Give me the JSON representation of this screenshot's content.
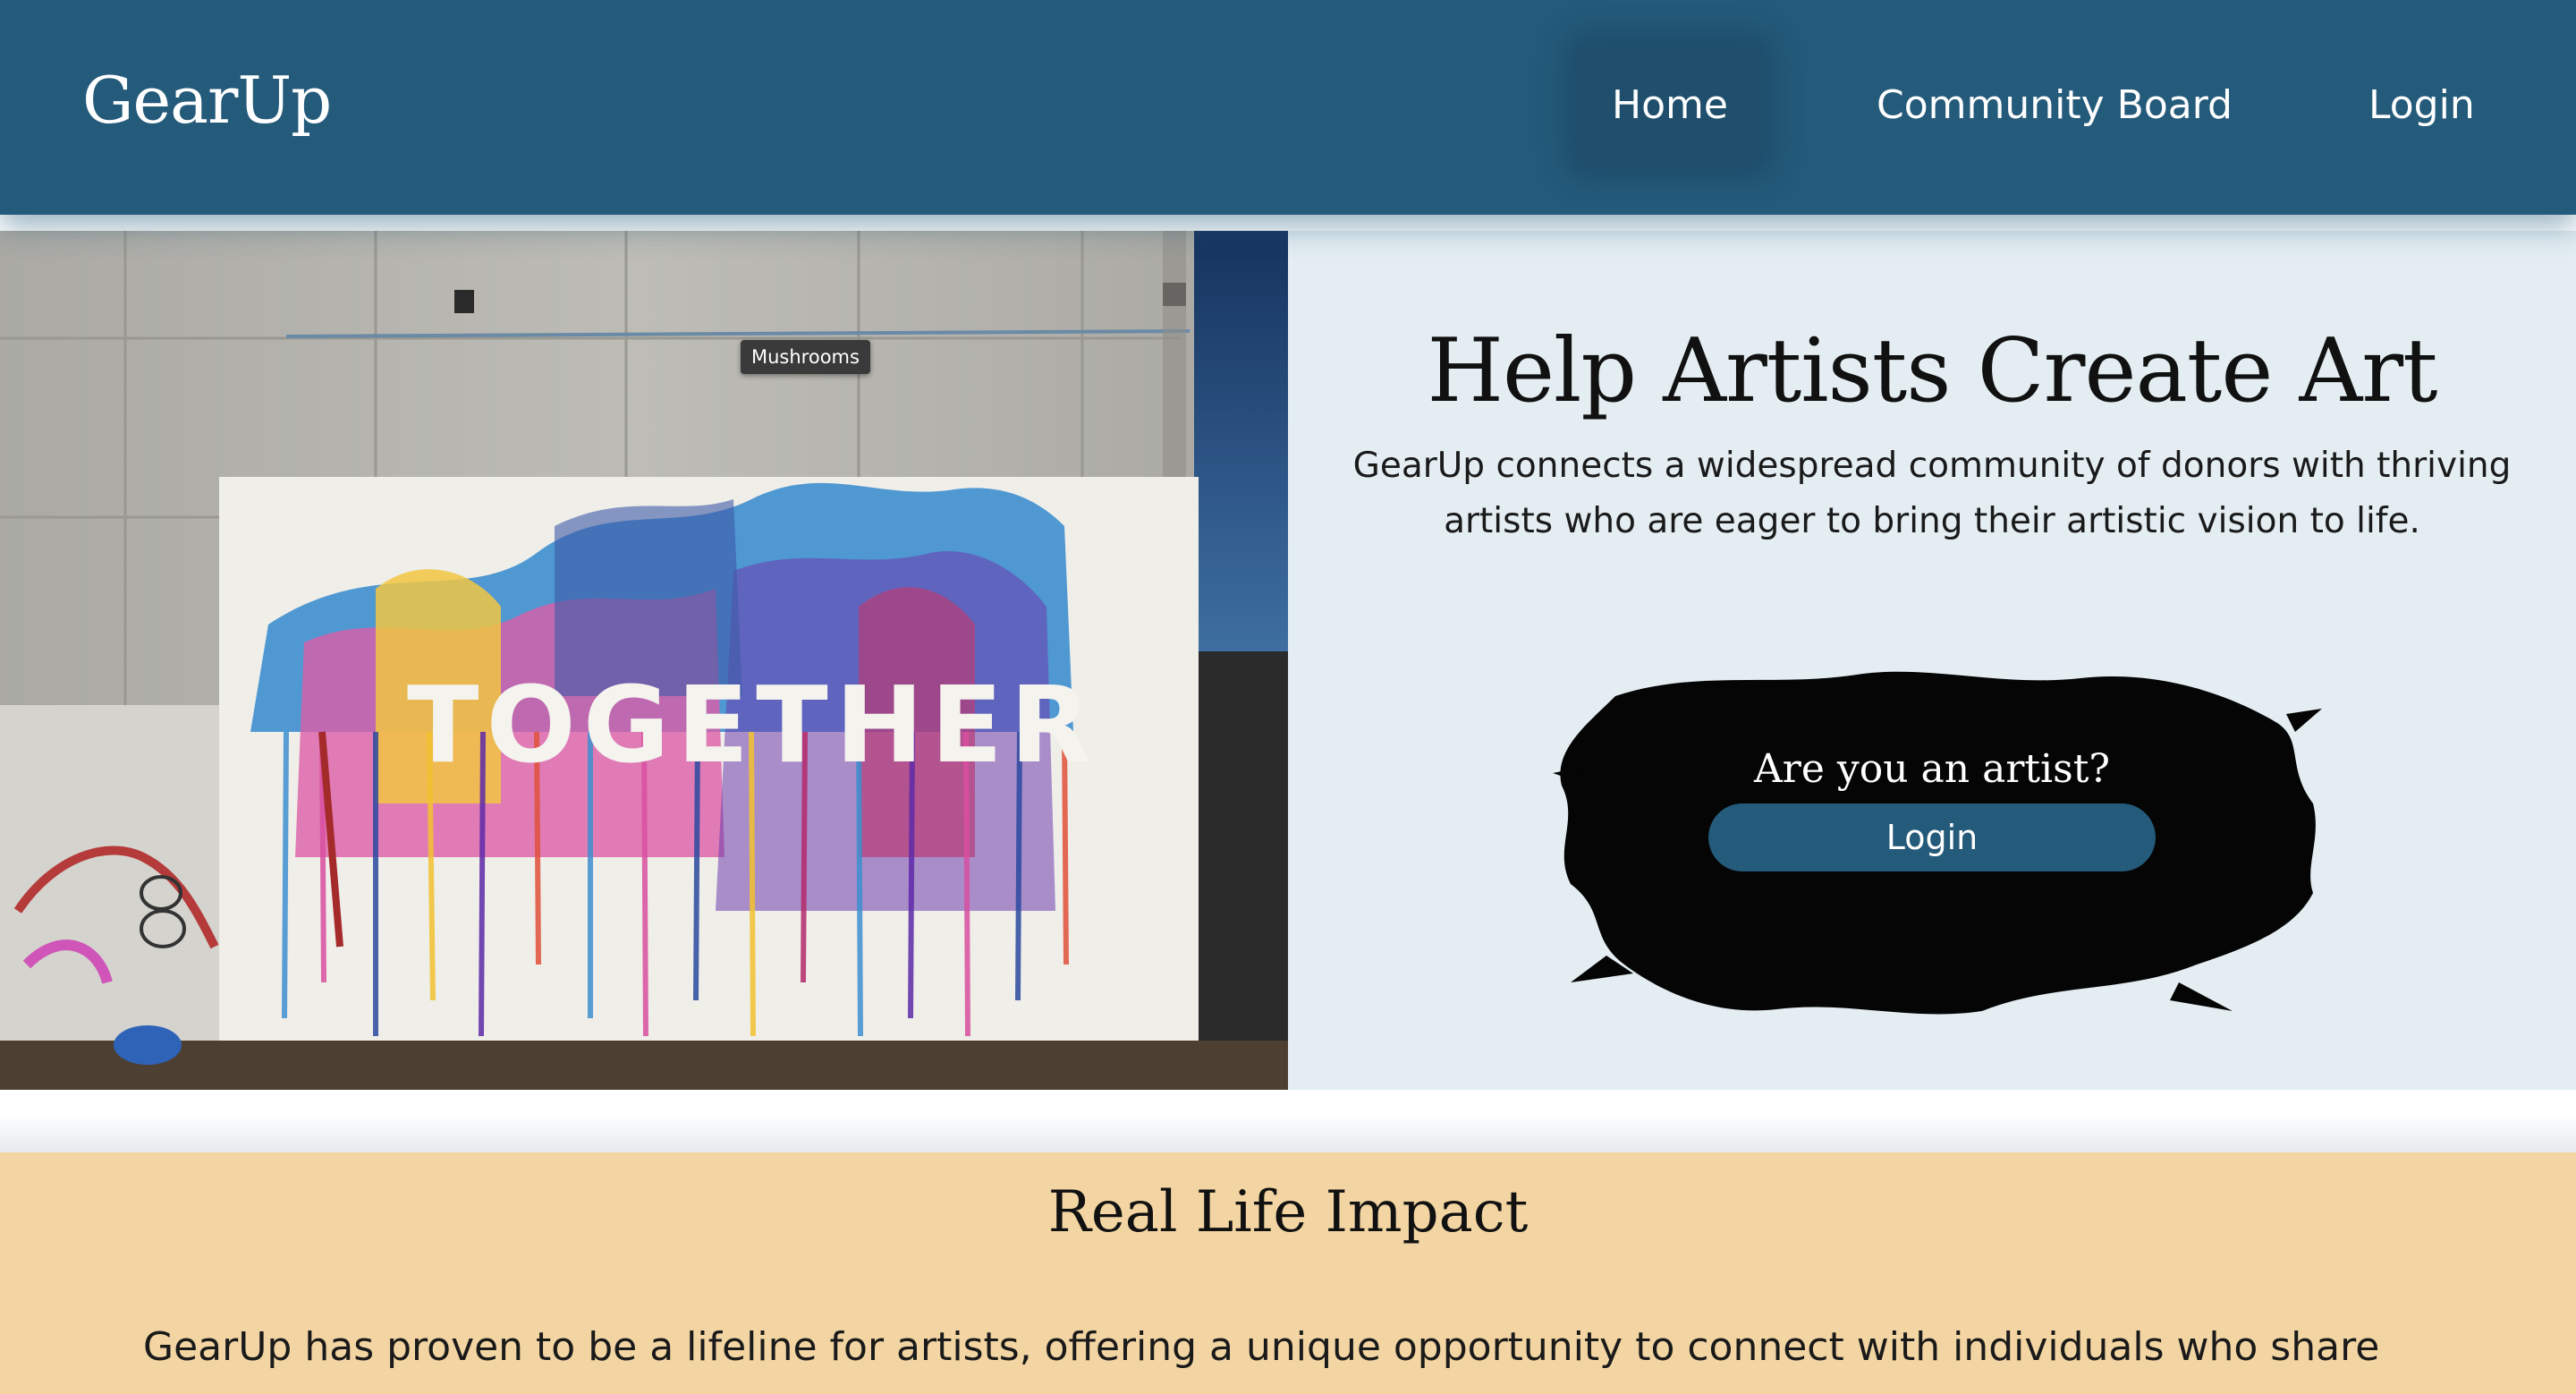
{
  "header": {
    "brand": "GearUp",
    "nav": {
      "home": "Home",
      "community": "Community Board",
      "login": "Login"
    }
  },
  "hero": {
    "image_text": "TOGETHER",
    "tooltip": "Mushrooms",
    "title": "Help Artists Create Art",
    "description": "GearUp connects a widespread community of donors with thriving artists who are eager to bring their artistic vision to life.",
    "artist_question": "Are you an artist?",
    "artist_login": "Login"
  },
  "impact": {
    "title": "Real Life Impact",
    "body": "GearUp has proven to be a lifeline for artists, offering a unique opportunity to connect with individuals who share"
  },
  "colors": {
    "header_bg": "#245a7a",
    "hero_bg": "#e3edf2",
    "impact_bg": "#f2d5a2",
    "button_bg": "#245a7a"
  }
}
